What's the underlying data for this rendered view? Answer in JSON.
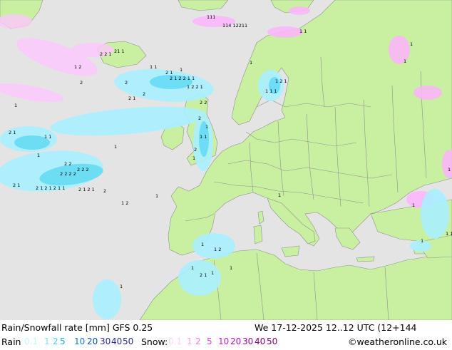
{
  "map": {
    "colors": {
      "sea": "#e4e4e4",
      "land": "#c8f0a0",
      "border": "#909090",
      "rain_light": "#aaf0ff",
      "rain_mid": "#66dcf4",
      "snow_light": "#ffb4ff",
      "snow_mid": "#f078f0",
      "label": "#000000"
    }
  },
  "footer": {
    "title": "Rain/Snowfall rate [mm] GFS 0.25",
    "datetime": "We 17-12-2025 12..12 UTC (12+144",
    "rain_label": "Rain",
    "rain_scale": [
      {
        "text": "0.1",
        "color": "#c8f6ff"
      },
      {
        "text": "1",
        "color": "#82e4f8"
      },
      {
        "text": "2",
        "color": "#48d0f0"
      },
      {
        "text": "5",
        "color": "#20a8e8"
      },
      {
        "text": "10",
        "color": "#1478d8"
      },
      {
        "text": "20",
        "color": "#0a4cc0"
      },
      {
        "text": "30",
        "color": "#2a2aa0"
      },
      {
        "text": "40",
        "color": "#2828a8"
      },
      {
        "text": "50",
        "color": "#282890"
      }
    ],
    "snow_label": "Snow:",
    "snow_scale": [
      {
        "text": "0.1",
        "color": "#ffd6ff"
      },
      {
        "text": "1",
        "color": "#f4a4f4"
      },
      {
        "text": "2",
        "color": "#ec7cec"
      },
      {
        "text": "5",
        "color": "#e040e0"
      },
      {
        "text": "10",
        "color": "#c820c8"
      },
      {
        "text": "20",
        "color": "#b010b0"
      },
      {
        "text": "30",
        "color": "#980898"
      },
      {
        "text": "40",
        "color": "#880088"
      },
      {
        "text": "50",
        "color": "#780078"
      }
    ],
    "credit": "©weatheronline.co.uk"
  }
}
